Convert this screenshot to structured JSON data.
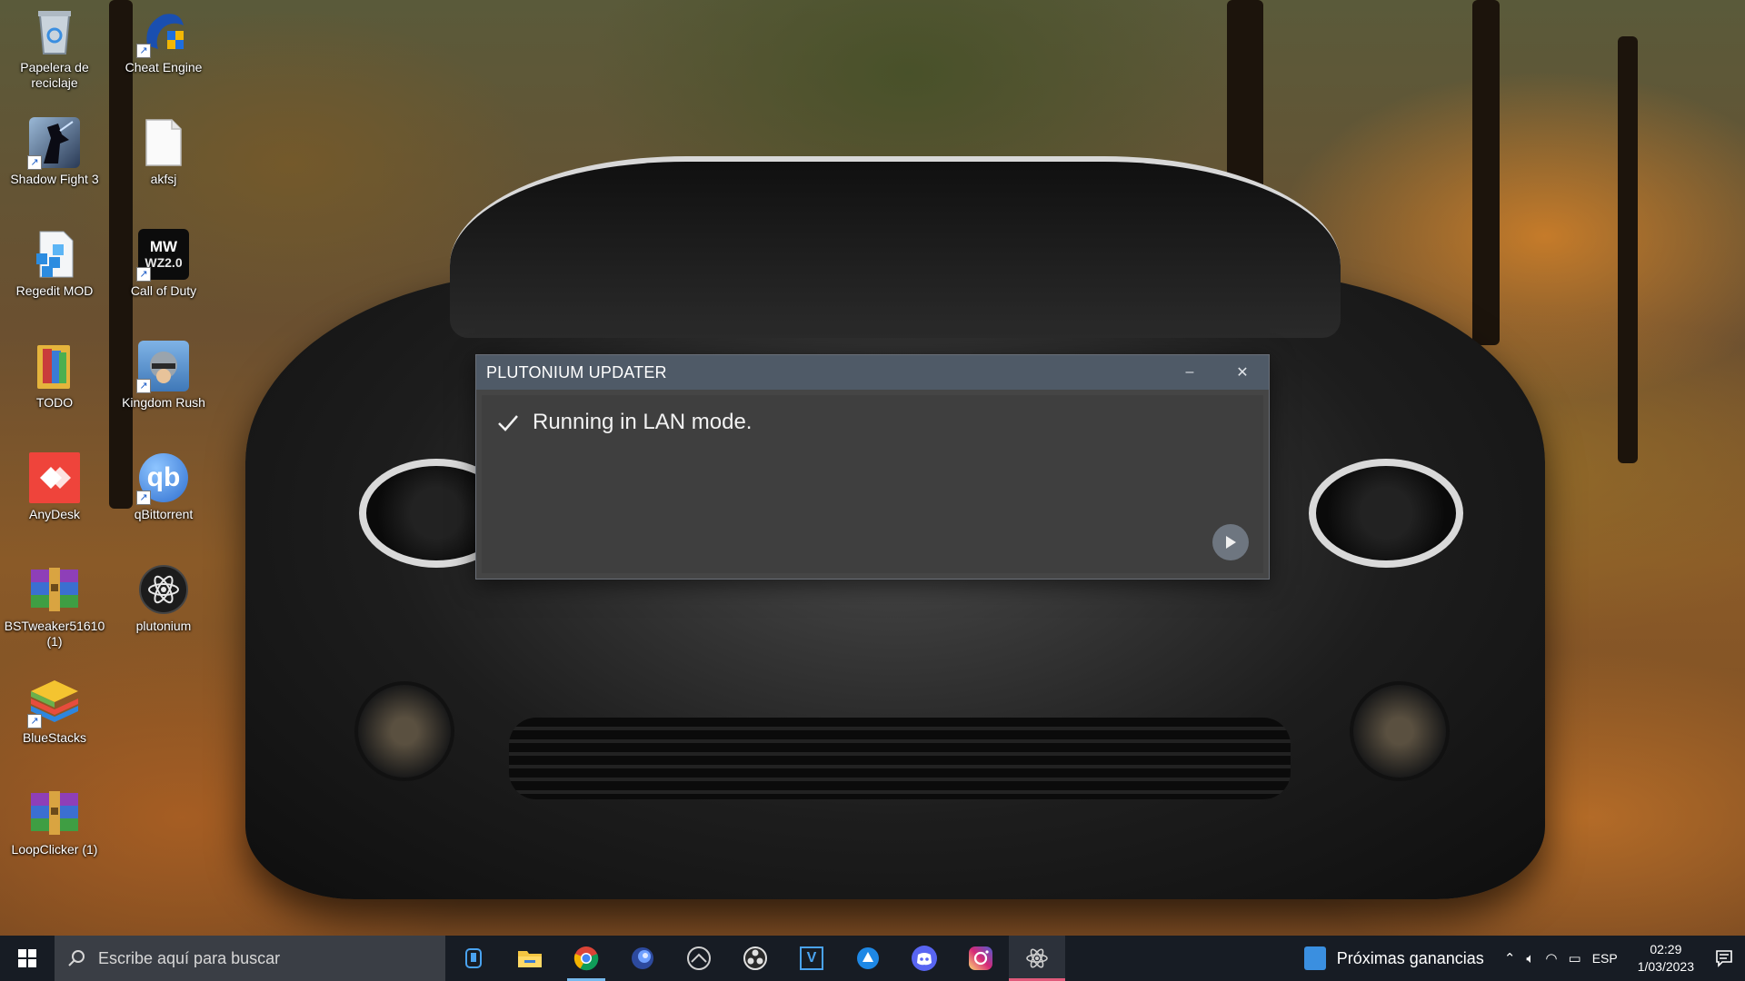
{
  "desktop": {
    "icons": [
      {
        "label": "Papelera de reciclaje",
        "icon": "recycle-bin-icon"
      },
      {
        "label": "Cheat Engine",
        "icon": "cheat-engine-icon"
      },
      {
        "label": "Shadow Fight 3",
        "icon": "shadow-fight-icon"
      },
      {
        "label": "akfsj",
        "icon": "blank-file-icon"
      },
      {
        "label": "Regedit MOD",
        "icon": "regedit-icon"
      },
      {
        "label": "Call of Duty",
        "icon": "call-of-duty-icon"
      },
      {
        "label": "TODO",
        "icon": "folder-icon"
      },
      {
        "label": "Kingdom Rush",
        "icon": "kingdom-rush-icon"
      },
      {
        "label": "AnyDesk",
        "icon": "anydesk-icon"
      },
      {
        "label": "qBittorrent",
        "icon": "qbittorrent-icon"
      },
      {
        "label": "BSTweaker51610 (1)",
        "icon": "winrar-icon"
      },
      {
        "label": "plutonium",
        "icon": "plutonium-icon"
      },
      {
        "label": "BlueStacks",
        "icon": "bluestacks-icon"
      },
      {
        "label": "LoopClicker (1)",
        "icon": "winrar-icon"
      }
    ],
    "cod_logo_top": "MW",
    "cod_logo_bottom": "WZ2.0",
    "qb_logo": "qb"
  },
  "updater": {
    "title": "PLUTONIUM UPDATER",
    "minimize_glyph": "–",
    "close_glyph": "✕",
    "status_message": "Running in LAN mode.",
    "status_icon": "checkmark-icon",
    "play_icon": "play-icon"
  },
  "taskbar": {
    "search_placeholder": "Escribe aquí para buscar",
    "apps": [
      {
        "name": "cortana-icon"
      },
      {
        "name": "file-explorer-icon"
      },
      {
        "name": "chrome-icon"
      },
      {
        "name": "browser-orb-icon"
      },
      {
        "name": "steam-like-icon"
      },
      {
        "name": "obs-icon"
      },
      {
        "name": "visual-studio-icon"
      },
      {
        "name": "app-icon"
      },
      {
        "name": "discord-icon"
      },
      {
        "name": "instagram-icon"
      },
      {
        "name": "plutonium-icon"
      }
    ],
    "vs_badge": "V",
    "news": "Próximas ganancias",
    "language": "ESP",
    "time": "02:29",
    "date": "1/03/2023"
  },
  "colors": {
    "window_title_bg": "#4f5a67",
    "window_body_bg": "#3f3f3f",
    "taskbar_bg": "#171c24",
    "search_bg": "#3a3e45"
  }
}
